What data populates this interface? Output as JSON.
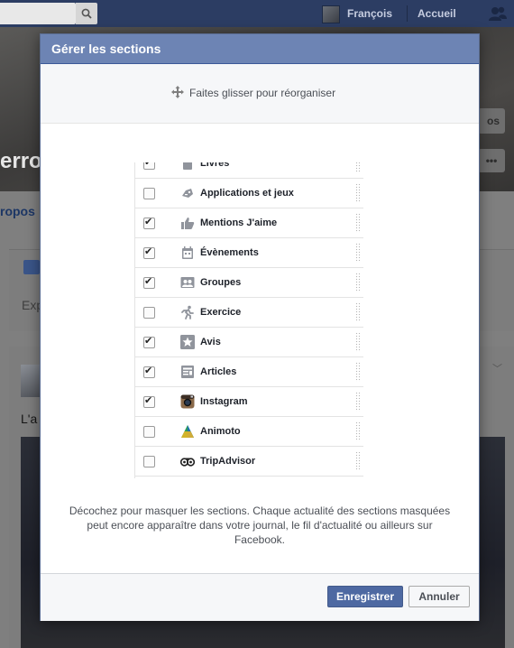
{
  "topbar": {
    "user_name": "François",
    "home_label": "Accueil"
  },
  "background": {
    "profile_name_partial": "erroy",
    "about_partial": "ropos",
    "status_partial": "Exp",
    "post_text_partial": "L'a",
    "cover_button_partial": "os",
    "more_button": "•••"
  },
  "modal": {
    "title": "Gérer les sections",
    "drag_hint": "Faites glisser pour réorganiser",
    "help_text": "Décochez pour masquer les sections. Chaque actualité des sections masquées peut encore apparaître dans votre journal, le fil d'actualité ou ailleurs sur Facebook.",
    "save_label": "Enregistrer",
    "cancel_label": "Annuler",
    "sections": [
      {
        "label": "Livres",
        "checked": true,
        "icon": "book-icon"
      },
      {
        "label": "Applications et jeux",
        "checked": false,
        "icon": "gamepad-icon"
      },
      {
        "label": "Mentions J'aime",
        "checked": true,
        "icon": "thumbs-up-icon"
      },
      {
        "label": "Évènements",
        "checked": true,
        "icon": "calendar-icon"
      },
      {
        "label": "Groupes",
        "checked": true,
        "icon": "group-icon"
      },
      {
        "label": "Exercice",
        "checked": false,
        "icon": "runner-icon"
      },
      {
        "label": "Avis",
        "checked": true,
        "icon": "star-icon"
      },
      {
        "label": "Articles",
        "checked": true,
        "icon": "article-icon"
      },
      {
        "label": "Instagram",
        "checked": true,
        "icon": "instagram-icon"
      },
      {
        "label": "Animoto",
        "checked": false,
        "icon": "animoto-icon"
      },
      {
        "label": "TripAdvisor",
        "checked": false,
        "icon": "tripadvisor-icon"
      }
    ]
  }
}
